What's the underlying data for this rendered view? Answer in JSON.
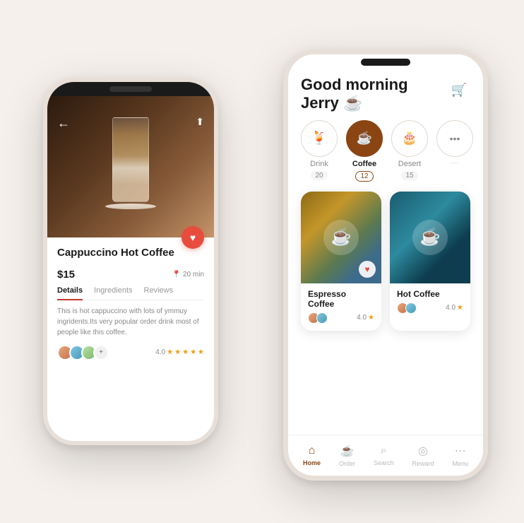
{
  "leftPhone": {
    "heroAlt": "Cappuccino coffee in tall glass",
    "backLabel": "←",
    "shareLabel": "⬆",
    "itemTitle": "Cappuccino Hot Coffee",
    "itemPrice": "$15",
    "itemTime": "20 min",
    "timePinIcon": "📍",
    "heartIcon": "♥",
    "tabs": [
      {
        "label": "Details",
        "active": true
      },
      {
        "label": "Ingredients",
        "active": false
      },
      {
        "label": "Reviews",
        "active": false
      }
    ],
    "description": "This is hot cappuccino with lots of ymmuy ingridents.Its very popular  order drink most of people like this coffee.",
    "rating": "4.0",
    "stars": [
      "★",
      "★",
      "★",
      "★",
      "★"
    ]
  },
  "rightPhone": {
    "greeting": "Good morning",
    "userName": "Jerry",
    "coffeeEmoji": "☕",
    "cartIcon": "🛒",
    "categories": [
      {
        "label": "Drink",
        "count": "20",
        "icon": "🍹",
        "active": false
      },
      {
        "label": "Coffee",
        "count": "12",
        "icon": "☕",
        "active": true
      },
      {
        "label": "Desert",
        "count": "15",
        "icon": "🎂",
        "active": false
      },
      {
        "label": "More",
        "count": "",
        "icon": "•••",
        "active": false
      }
    ],
    "coffeeItems": [
      {
        "name": "Espresso Coffee",
        "rating": "4.0",
        "starIcon": "★",
        "hasHeart": true,
        "imgType": "espresso"
      },
      {
        "name": "Hot Coffee",
        "rating": "4.0",
        "starIcon": "★",
        "hasHeart": false,
        "imgType": "hot"
      }
    ],
    "nav": [
      {
        "label": "Home",
        "icon": "⌂",
        "active": true
      },
      {
        "label": "Order",
        "icon": "☕",
        "active": false
      },
      {
        "label": "Search",
        "icon": "⌕",
        "active": false
      },
      {
        "label": "Reward",
        "icon": "◎",
        "active": false
      },
      {
        "label": "Menu",
        "icon": "⋯",
        "active": false
      }
    ]
  }
}
